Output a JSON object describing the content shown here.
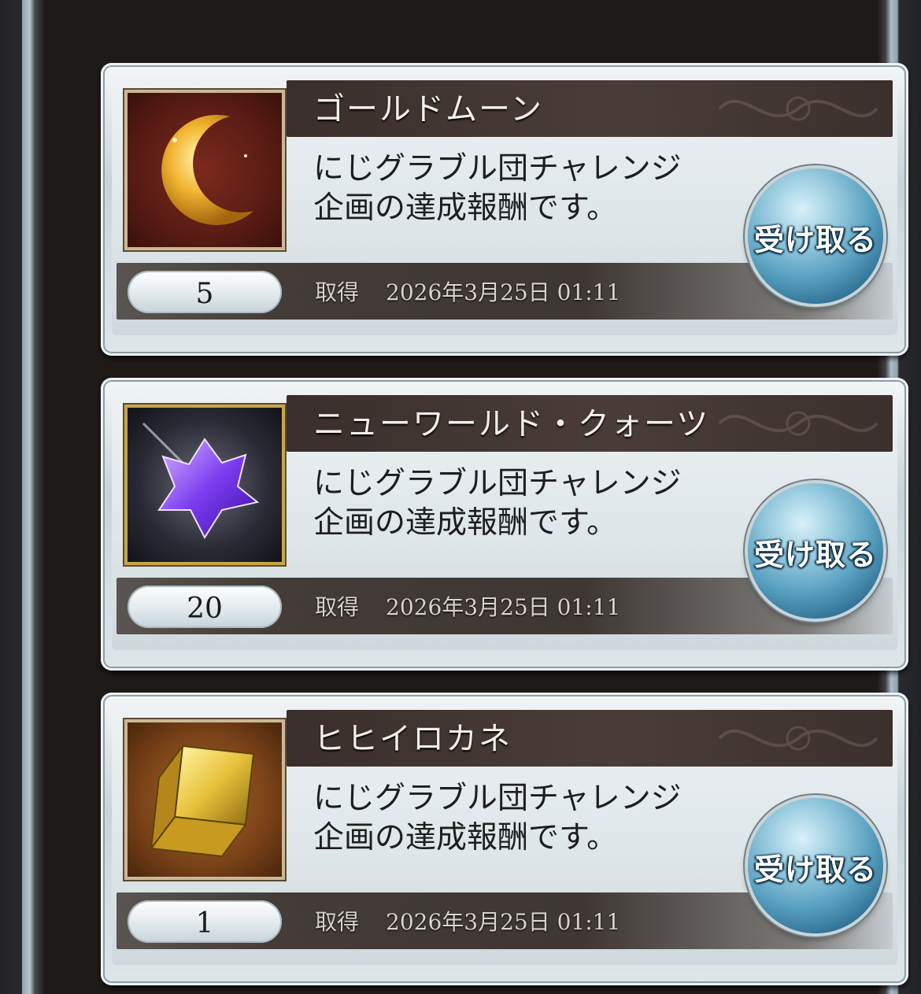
{
  "items": [
    {
      "name": "ゴールドムーン",
      "description": "にじグラブル団チャレンジ\n企画の達成報酬です。",
      "quantity": "5",
      "acquired_label": "取得",
      "acquired_date": "2026年3月25日 01:11",
      "claim_label": "受け取る",
      "icon": "gold-moon-icon"
    },
    {
      "name": "ニューワールド・クォーツ",
      "description": "にじグラブル団チャレンジ\n企画の達成報酬です。",
      "quantity": "20",
      "acquired_label": "取得",
      "acquired_date": "2026年3月25日 01:11",
      "claim_label": "受け取る",
      "icon": "new-world-quartz-icon"
    },
    {
      "name": "ヒヒイロカネ",
      "description": "にじグラブル団チャレンジ\n企画の達成報酬です。",
      "quantity": "1",
      "acquired_label": "取得",
      "acquired_date": "2026年3月25日 01:11",
      "claim_label": "受け取る",
      "icon": "hihiirokane-icon"
    }
  ],
  "colors": {
    "title_bar": "#3a2f2c",
    "claim_button": "#5aa1c1",
    "card_bg": "#dfe6e9"
  }
}
